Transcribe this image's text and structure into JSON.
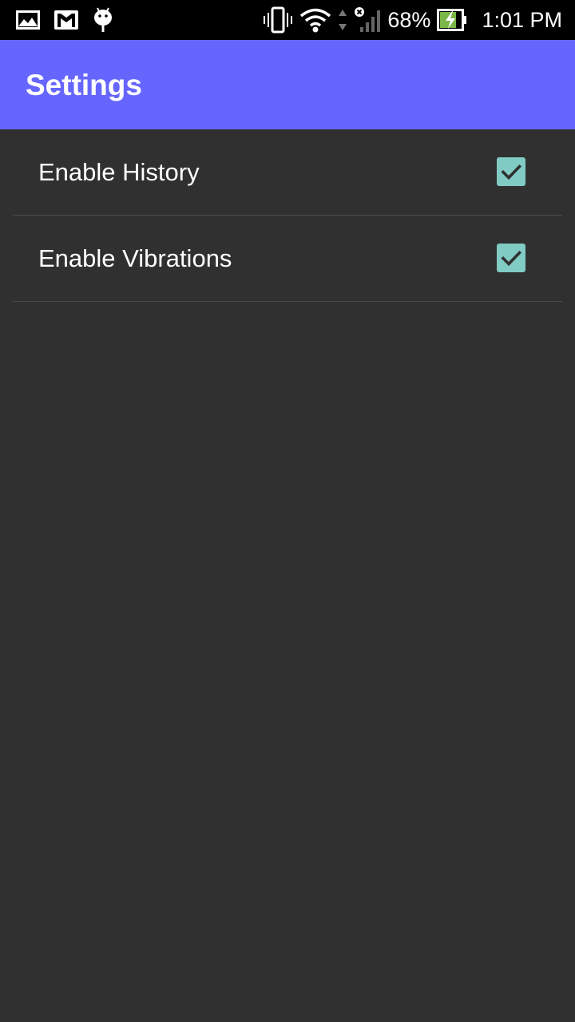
{
  "status_bar": {
    "left_icons": [
      "gallery-icon",
      "gmail-icon",
      "android-debug-icon"
    ],
    "right_icons": [
      "vibrate-icon",
      "wifi-icon",
      "data-arrows-icon",
      "no-signal-icon"
    ],
    "battery_percent": "68%",
    "battery_icon": "battery-charging-icon",
    "time": "1:01 PM"
  },
  "app_bar": {
    "title": "Settings",
    "color": "#6666ff"
  },
  "settings": [
    {
      "label": "Enable History",
      "checked": true
    },
    {
      "label": "Enable Vibrations",
      "checked": true
    }
  ],
  "colors": {
    "background": "#303030",
    "checkbox": "#80cbc4",
    "divider": "#4a4a4a"
  }
}
